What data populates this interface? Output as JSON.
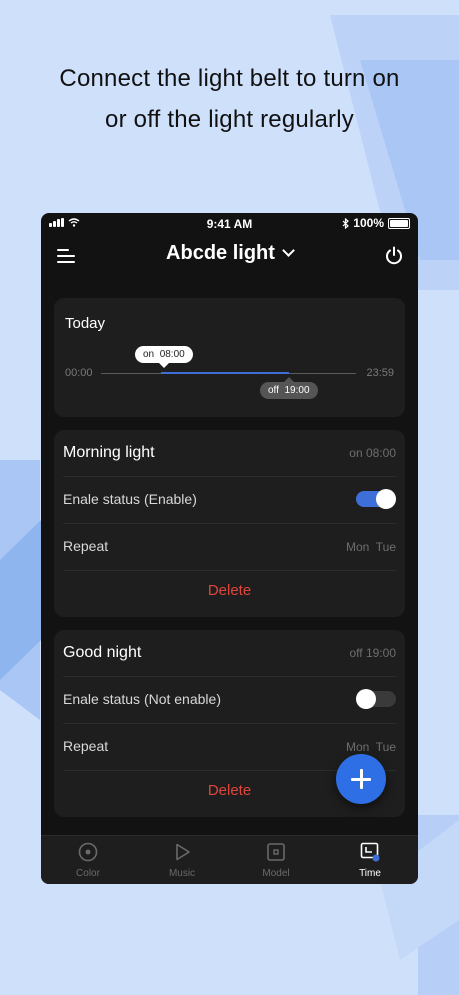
{
  "headline": {
    "line1": "Connect the light belt to turn on",
    "line2": "or off the light regularly"
  },
  "status_bar": {
    "time": "9:41 AM",
    "battery": "100%",
    "icons": [
      "signal-icon",
      "wifi-icon",
      "bluetooth-icon",
      "battery-icon"
    ]
  },
  "header": {
    "title": "Abcde light",
    "menu_icon": "menu-icon",
    "dropdown_icon": "chevron-down-icon",
    "power_icon": "power-icon"
  },
  "today": {
    "title": "Today",
    "start": "00:00",
    "end": "23:59",
    "on_label": "on",
    "on_time": "08:00",
    "off_label": "off",
    "off_time": "19:00"
  },
  "timers": [
    {
      "name": "Morning light",
      "summary": "on 08:00",
      "status_label": "Enale status (Enable)",
      "enabled": true,
      "repeat_label": "Repeat",
      "repeat_days": "Mon  Tue",
      "delete_label": "Delete"
    },
    {
      "name": "Good night",
      "summary": "off 19:00",
      "status_label": "Enale status (Not enable)",
      "enabled": false,
      "repeat_label": "Repeat",
      "repeat_days": "Mon  Tue",
      "delete_label": "Delete"
    }
  ],
  "tabs": [
    {
      "label": "Color",
      "icon": "color-icon",
      "active": false
    },
    {
      "label": "Music",
      "icon": "music-icon",
      "active": false
    },
    {
      "label": "Model",
      "icon": "model-icon",
      "active": false
    },
    {
      "label": "Time",
      "icon": "time-icon",
      "active": true
    }
  ],
  "colors": {
    "accent": "#3e6fd8",
    "delete": "#e0463c",
    "background": "#cfe0fb",
    "card": "#1e1e1e"
  }
}
